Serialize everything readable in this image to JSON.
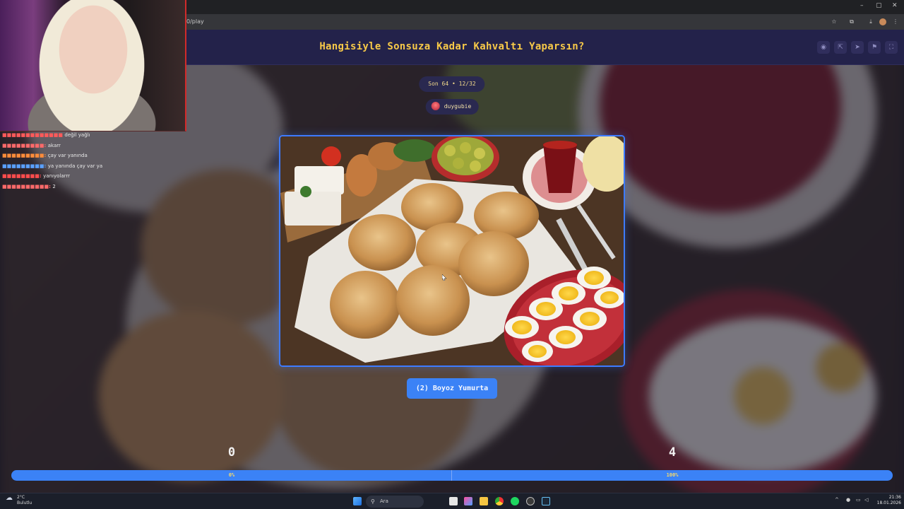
{
  "browser": {
    "url": "0/play",
    "window_controls": [
      "–",
      "▢",
      "✕"
    ]
  },
  "game": {
    "title": "Hangisiyle Sonsuza Kadar Kahvaltı Yaparsın?",
    "round_label": "Son 64 • 12/32",
    "creator": "duygubie",
    "choice_label": "(2) Boyoz Yumurta",
    "score_left": "0",
    "score_right": "4",
    "percent_left_label": "0%",
    "percent_right_label": "100%",
    "progress_fraction_right": 1.0
  },
  "header_icons": [
    "eye-icon",
    "share-icon",
    "send-icon",
    "bookmark-icon",
    "fullscreen-icon"
  ],
  "chat": {
    "messages": [
      {
        "user": "",
        "text": "değil yağlı",
        "color": "#ffffff"
      },
      {
        "user": "",
        "text": "akarr",
        "color": "#ff6a6a"
      },
      {
        "user": "",
        "text": "çay var yanında",
        "color": "#ff8c3a"
      },
      {
        "user": "",
        "text": "ya yanında çay var ya",
        "color": "#5aa0ff"
      },
      {
        "user": "",
        "text": "yanıyolarrr",
        "color": "#ff4d4d"
      },
      {
        "user": "",
        "text": "2",
        "color": "#ff6a6a"
      }
    ]
  },
  "taskbar": {
    "weather_temp": "2°C",
    "weather_desc": "Bulutlu",
    "search_placeholder": "Ara",
    "time": "21:36",
    "date": "18.01.2026",
    "apps": [
      "windows-start-icon",
      "file-explorer-icon",
      "photos-icon",
      "folder-icon",
      "chrome-icon",
      "spotify-icon",
      "obs-icon",
      "steam-icon"
    ]
  },
  "colors": {
    "accent_blue": "#3b82f6",
    "title_yellow": "#f7c948",
    "header_bg": "#23224a"
  }
}
